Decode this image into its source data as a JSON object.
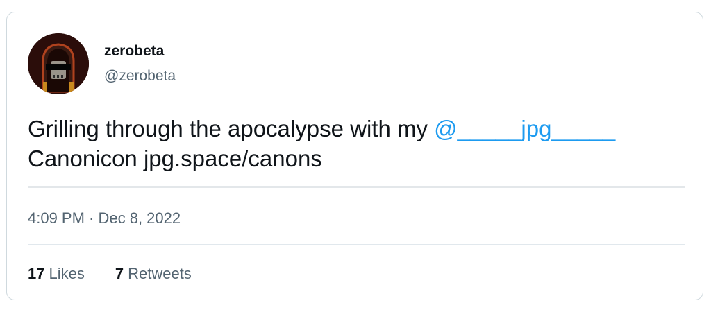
{
  "user": {
    "display_name": "zerobeta",
    "handle": "@zerobeta",
    "avatar_icon": "hooded-skull-avatar"
  },
  "tweet": {
    "text_before_mention": "Grilling through the apocalypse with my ",
    "mention": "@_____jpg_____",
    "text_after_mention": "Canonicon jpg.space/canons",
    "timestamp": "4:09 PM · Dec 8, 2022"
  },
  "stats": {
    "likes_count": "17",
    "likes_label": "Likes",
    "retweets_count": "7",
    "retweets_label": "Retweets"
  },
  "colors": {
    "mention": "#1d9bf0",
    "text": "#0f1419",
    "muted": "#536471",
    "border": "#cfd9de"
  }
}
